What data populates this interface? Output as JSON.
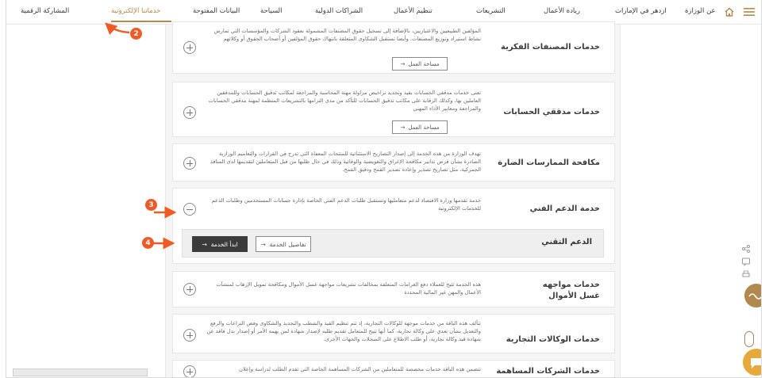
{
  "nav": {
    "items": [
      {
        "label": "المشاركة الرقمية"
      },
      {
        "label": "خدماتنا الإلكترونية"
      },
      {
        "label": "البيانات المفتوحة"
      },
      {
        "label": "السياحة"
      },
      {
        "label": "الشراكات الدولية"
      },
      {
        "label": "تنظيم الأعمال"
      },
      {
        "label": "التشريعات"
      },
      {
        "label": "ريادة الأعمال"
      },
      {
        "label": "ازدهر في الإمارات"
      },
      {
        "label": "عن الوزارة"
      }
    ],
    "home_icon": "home-icon",
    "menu_icon": "hamburger-menu-icon"
  },
  "cards": [
    {
      "title": "خدمات المصنفات الفكرية",
      "desc": "المؤلفين الطبيعيين والاعتباريين، بالإضافة إلى تسجيل حقوق المصنفات المشمولة بعقود الشركات والمؤسسات التي تمارس نشاط استيراد وتوزيع المصنفات. وأيضا تستقبل الشكاوى المتعلقة بانتهاك حقوق المؤلفين أو أصحاب الحقوق أو وكلائهم",
      "button": "مساحة العمل"
    },
    {
      "title": "خدمات مدققي الحسابات",
      "desc": "تعنى خدمات مدققي الحسابات بقيد وتجديد تراخيص مزاولة مهنة المحاسبة والمراجعة لمكاتب تدقيق الحسابات وللمدققين العاملين بها، وكذلك الرقابة على مكاتب تدقيق الحسابات للتأكد من مدى التزامها بالتشريعات المنظمة لمهنة مدققي الحسابات والمراجعة ومعايير الأداء المهني",
      "button": "مساحة العمل"
    },
    {
      "title": "مكافحة الممارسات الضارة",
      "desc": "تهدف الوزارة من هذه الخدمة إلى إصدار التصاريح الاستثنائية للمنتجات المعفاة التي تدرج في القرارات والتعاميم الوزارية الصادرة بشأن فرض تدابير مكافحة الإغراق والتعويضية والوقائية وذلك في حال طلبها من قبل المتعاملين لتقديمها لدى المنافذ الجمركية، مثل تصاريح تصدير وإعادة تصدير القمح ودقيق القمح."
    },
    {
      "title": "خدمة الدعم الفني",
      "desc": "خدمة تقدمها وزارة الاقتصاد لدعم متعامليها وتستقبل طلبات الدعم الفني الخاصة بإدارة حسابات المستخدمين وطلبات الدعم للخدمات الإلكترونية"
    },
    {
      "title": "خدمات مواجهه غسل الأموال",
      "desc": "هذه الخدمة تتيح للعملاء دفع الغرامات المتعلقة بمخالفات تشريعات مواجهة غسل الأموال ومكافحة تمويل الإرهاب لمنشآت الأعمال والمهن غير المالية المحددة"
    },
    {
      "title": "خدمات الوكالات التجارية",
      "desc": "تتألف هذه الباقة من خدمات موجهة للوكالات التجارية، إذ تتم تنظيم القيد والشطب والتجديد والشكاوى وفض النزاعات والرفع والتعديل بشأن تعدي على وكالة تجارية، كما أنها تتيح للمتعامل تقديم طلبه لإصدار شهادة لمن يهمه الأمر أو إصدار بدل فاقد عن شهادة قيد وكالة تجارية، أو طلب الاطلاع على السجلات والجهات الأخرى."
    },
    {
      "title": "خدمات الشركات المساهمة",
      "desc": "تتضمن هذه الباقة خدمات مخصصة للمتعاملين من الشركات المساهمة الخاصة التي تقدم الطلب لدراسة وإعلان"
    }
  ],
  "sub_service": {
    "title": "الدعم التقني",
    "details_label": "تفاصيل الخدمة",
    "start_label": "ابدأ الخدمة"
  },
  "annotations": [
    "2",
    "3",
    "4"
  ],
  "colors": {
    "accent": "#b4894c",
    "annotation": "#f05a24",
    "dark_button": "#3b3b3b"
  }
}
